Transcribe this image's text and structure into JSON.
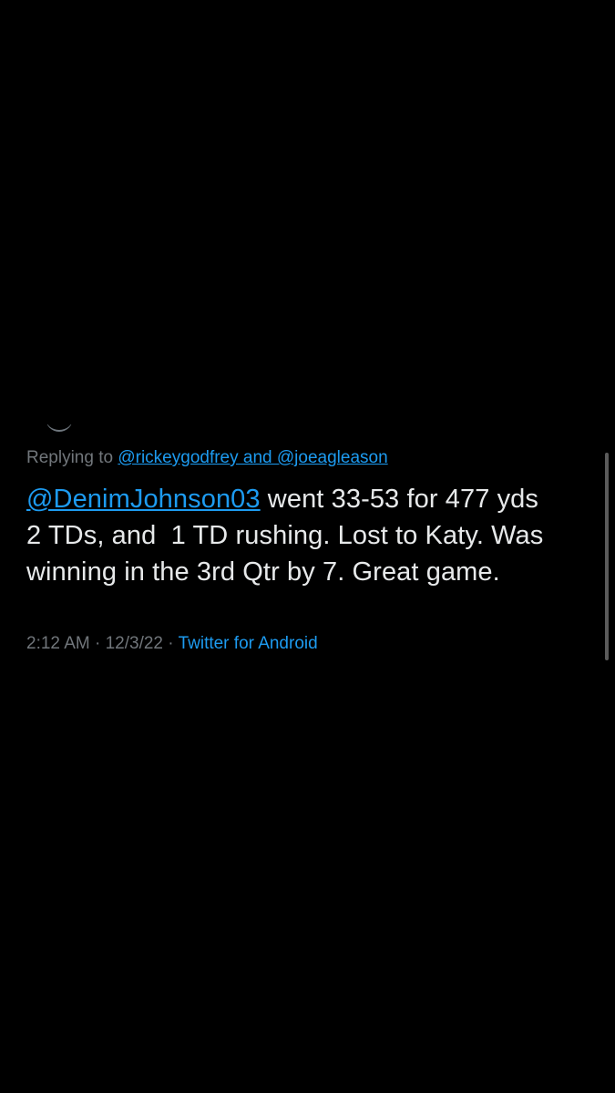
{
  "reply": {
    "prefix": "Replying to ",
    "handles": "@rickeygodfrey and @joeagleason"
  },
  "tweet": {
    "mention": "@DenimJohnson03",
    "line1_rest": " went 33-53 for 477 yds",
    "line2": "2 TDs, and  1 TD rushing. Lost to Katy. Was",
    "line3": "winning in the 3rd Qtr by 7. Great game."
  },
  "meta": {
    "time": "2:12 AM",
    "separator1": " · ",
    "date": "12/3/22",
    "separator2": " · ",
    "source": "Twitter for Android"
  },
  "colors": {
    "background": "#000000",
    "text": "#e7e9ea",
    "secondary": "#71767b",
    "link": "#1d9bf0"
  }
}
